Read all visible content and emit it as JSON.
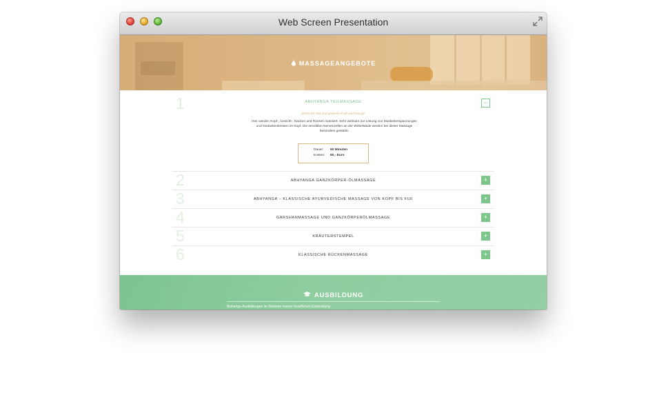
{
  "window": {
    "title": "Web Screen Presentation"
  },
  "hero": {
    "heading": "MASSAGEANGEBOTE"
  },
  "accordion": {
    "open": {
      "number": "1",
      "title": "ABHYANGA TEILMASSAGE",
      "subtitle": "Nimm Dir Zeit und gewinne Kraft und Energie",
      "description": "Hier werden Kopf-, Gesicht-, Nacken und Rücken massiert. Sehr wirksam zur Lösung von Muskelverspannungen und Gedankenkreisen im Kopf. Die sensiblen Nervenzellen an der Wirbelsäule werden bei dieser Massage besonders gestärkt.",
      "duration_label": "Dauer:",
      "duration_value": "60 Minuten",
      "cost_label": "Kosten:",
      "cost_value": "60,- Euro",
      "toggle_symbol": "−"
    },
    "items": [
      {
        "number": "2",
        "title": "ABHYANGA GANZKÖRPER-ÖLMASSAGE",
        "toggle_symbol": "+"
      },
      {
        "number": "3",
        "title": "ABHYANGA – KLASSISCHE AYURVEDISCHE MASSAGE VON KOPF BIS FUß",
        "toggle_symbol": "+"
      },
      {
        "number": "4",
        "title": "GARSHANMASSAGE  UND GANZKÖRPERÖLMASSAGE",
        "toggle_symbol": "+"
      },
      {
        "number": "5",
        "title": "KRÄUTERSTEMPEL",
        "toggle_symbol": "+"
      },
      {
        "number": "6",
        "title": "KLASSISCHE RÜCKENMASSAGE",
        "toggle_symbol": "+"
      }
    ]
  },
  "ausbildung": {
    "heading": "AUSBILDUNG",
    "text": "Bisherige Ausbildungen im Rahmen meiner beruflichen Entwicklung"
  },
  "colors": {
    "accent_green": "#7cc68b",
    "accent_gold": "#d8b67d",
    "hero_tone": "#dcb785"
  },
  "icons": {
    "hero": "drop-icon",
    "ausbildung": "graduation-cap-icon",
    "window": "fullscreen-icon"
  }
}
